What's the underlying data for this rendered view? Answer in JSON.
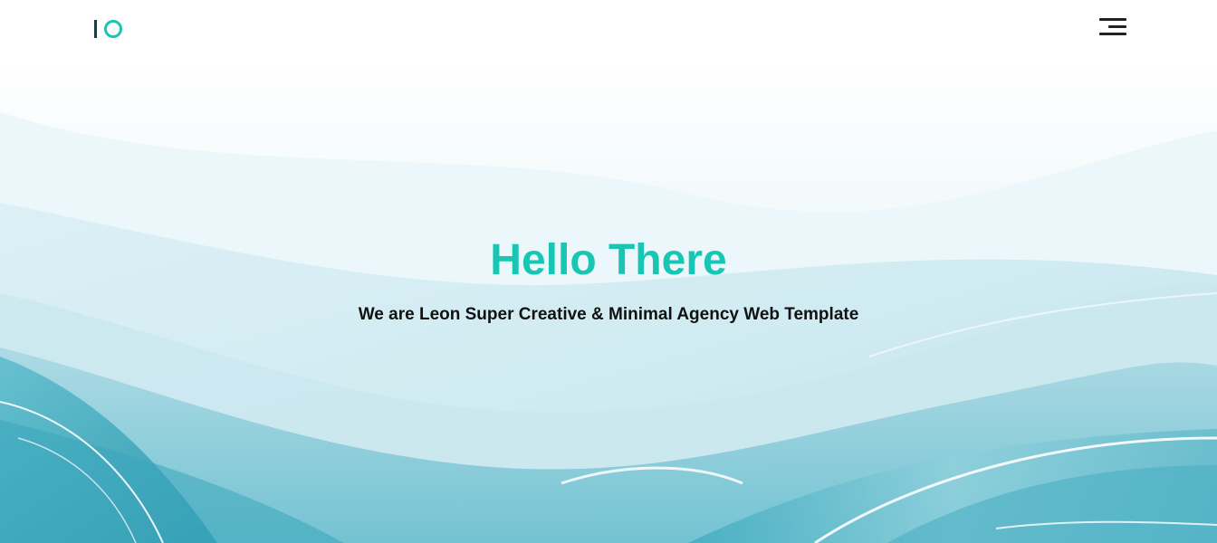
{
  "header": {
    "logo_icon": "io-logo-icon",
    "menu_icon": "hamburger-menu-icon"
  },
  "hero": {
    "title": "Hello There",
    "subtitle": "We are Leon Super Creative & Minimal Agency Web Template"
  },
  "colors": {
    "accent": "#19c6b4",
    "logo_dark": "#1f3b46",
    "text": "#111111",
    "background_light": "#eef8fb",
    "background_teal": "#2b98ad"
  }
}
